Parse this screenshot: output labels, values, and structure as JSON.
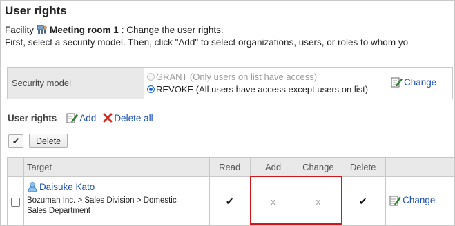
{
  "page": {
    "title": "User rights",
    "facility_prefix": "Facility",
    "facility_icon": "facility-icon",
    "facility_name": "Meeting room 1",
    "facility_suffix": ": Change the user rights.",
    "instruction": "First, select a security model. Then, click \"Add\" to select organizations, users, or roles to whom yo"
  },
  "security_model": {
    "label": "Security model",
    "options": [
      {
        "label": "GRANT (Only users on list have access)",
        "selected": false,
        "disabled": true
      },
      {
        "label": "REVOKE (All users have access except users on list)",
        "selected": true,
        "disabled": false
      }
    ],
    "change_label": "Change",
    "change_icon": "edit-icon"
  },
  "user_rights": {
    "label": "User rights",
    "add_label": "Add",
    "add_icon": "add-icon",
    "delete_all_label": "Delete all",
    "delete_all_icon": "delete-x-icon"
  },
  "toolbar": {
    "check_all_symbol": "✔",
    "delete_label": "Delete"
  },
  "table": {
    "headers": {
      "target": "Target",
      "read": "Read",
      "add": "Add",
      "change": "Change",
      "delete": "Delete"
    },
    "rows": [
      {
        "name": "Daisuke Kato",
        "user_icon": "user-icon",
        "org_path": "Bozuman Inc. > Sales Division > Domestic Sales Department",
        "read": "✔",
        "add": "x",
        "change": "x",
        "delete": "✔",
        "change_label": "Change"
      }
    ]
  },
  "colors": {
    "link": "#1a4fb8",
    "header_bg": "#e9e9e9",
    "highlight": "#d7141a",
    "radio_selected": "#1a63d4"
  }
}
